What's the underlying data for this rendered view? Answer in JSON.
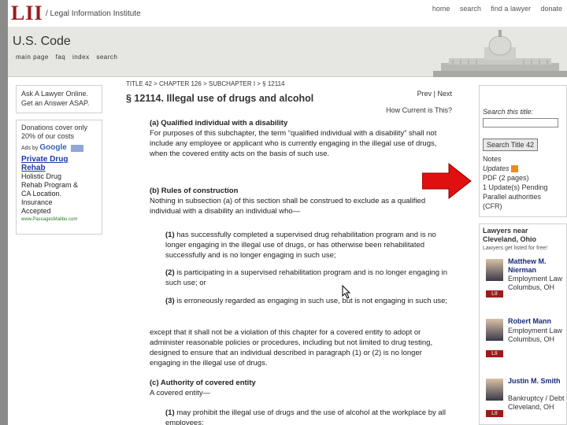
{
  "topbar": {
    "logo": "LII",
    "institute": "/ Legal Information Institute",
    "nav": [
      "home",
      "search",
      "find a lawyer",
      "donate"
    ]
  },
  "header": {
    "title": "U.S. Code",
    "subnav": [
      "main page",
      "faq",
      "index",
      "search"
    ]
  },
  "left": {
    "ask_line1": "Ask A Lawyer Online.",
    "ask_line2": "Get an Answer ASAP.",
    "donate_line1": "Donations cover only",
    "donate_line2": "20% of our costs",
    "ads_by": "Ads by",
    "google": "Google",
    "ad_link1": "Private Drug",
    "ad_link2": "Rehab",
    "ad_text": [
      "Holistic Drug",
      "Rehab Program &",
      "CA Location.",
      "Insurance",
      "Accepted"
    ],
    "ad_url": "www.PassagesMalibu.com"
  },
  "main": {
    "breadcrumb": "TITLE 42 > CHAPTER 126 > SUBCHAPTER I > § 12114",
    "prev": "Prev",
    "next": "Next",
    "title": "§ 12114. Illegal use of drugs and alcohol",
    "current": "How Current is This?",
    "a_head": "(a) Qualified individual with a disability",
    "a_text": "For purposes of this subchapter, the term “qualified individual with a disability” shall not include any employee or applicant who is currently engaging in the illegal use of drugs, when the covered entity acts on the basis of such use.",
    "b_head": "(b) Rules of construction",
    "b_text": "Nothing in subsection (a) of this section shall be construed to exclude as a qualified individual with a disability an individual who—",
    "b1_num": "(1)",
    "b1_text": "has successfully completed a supervised drug rehabilitation program and is no longer engaging in the illegal use of drugs, or has otherwise been rehabilitated successfully and is no longer engaging in such use;",
    "b2_num": "(2)",
    "b2_text": "is participating in a supervised rehabilitation program and is no longer engaging in such use; or",
    "b3_num": "(3)",
    "b3_text": "is erroneously regarded as engaging in such use, but is not engaging in such use;",
    "b_tail": "except that it shall not be a violation of this chapter for a covered entity to adopt or administer reasonable policies or procedures, including but not limited to drug testing, designed to ensure that an individual described in paragraph (1) or (2) is no longer engaging in the illegal use of drugs.",
    "c_head": "(c) Authority of covered entity",
    "c_text": "A covered entity—",
    "c1_num": "(1)",
    "c1_text": "may prohibit the illegal use of drugs and the use of alcohol at the workplace by all employees;"
  },
  "right": {
    "search_label": "Search this title:",
    "search_value": "",
    "search_button": "Search Title 42",
    "notes": "Notes",
    "updates": "Updates",
    "pdf": "PDF (2 pages)",
    "update_pending": "1 Update(s) Pending",
    "parallel": "Parallel authorities",
    "cfr": "(CFR)",
    "lawyers_head": "Lawyers near",
    "lawyers_city": "Cleveland, Ohio",
    "lawyers_sub": "Lawyers get listed for free!",
    "lawyers": [
      {
        "name": "Matthew M. Nierman",
        "info": "Employment Law Columbus, OH"
      },
      {
        "name": "Robert Mann",
        "info": "Employment Law Columbus, OH"
      },
      {
        "name": "Justin M. Smith",
        "info": "Bankruptcy / Debt Cleveland, OH"
      }
    ],
    "lii_badge": "LII"
  },
  "colors": {
    "brand_red": "#9b1b1b",
    "arrow_red": "#e01010",
    "link_blue": "#1a3aa8"
  }
}
